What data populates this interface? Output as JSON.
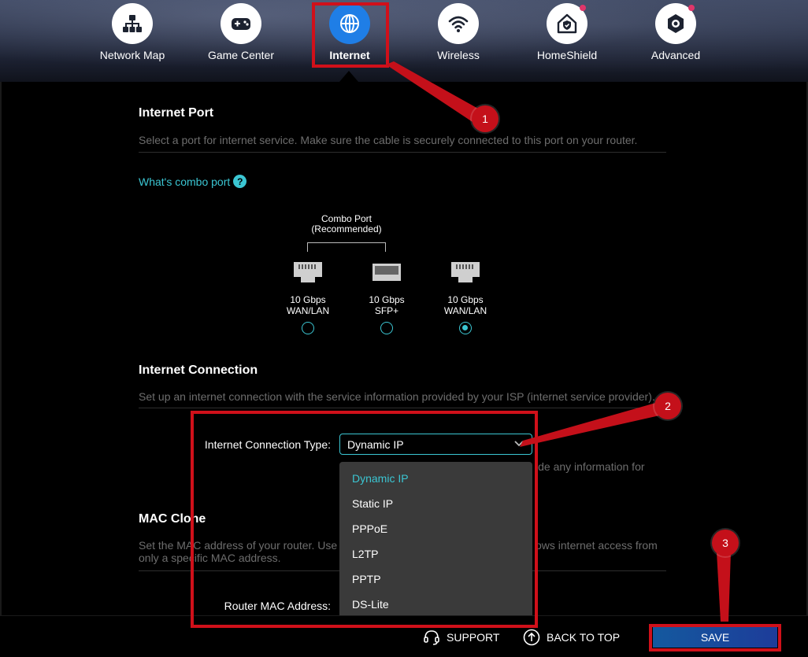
{
  "nav": {
    "items": [
      {
        "label": "Network Map",
        "icon": "network-map-icon"
      },
      {
        "label": "Game Center",
        "icon": "gamepad-icon"
      },
      {
        "label": "Internet",
        "icon": "globe-icon",
        "active": true
      },
      {
        "label": "Wireless",
        "icon": "wifi-icon"
      },
      {
        "label": "HomeShield",
        "icon": "home-shield-icon",
        "notification": true
      },
      {
        "label": "Advanced",
        "icon": "gear-icon",
        "notification": true
      }
    ]
  },
  "internet_port": {
    "title": "Internet Port",
    "description": "Select a port for internet service. Make sure the cable is securely connected to this port on your router.",
    "combo_link": "What's combo port",
    "combo_caption_line1": "Combo Port",
    "combo_caption_line2": "(Recommended)",
    "ports": [
      {
        "speed": "10 Gbps",
        "type": "WAN/LAN",
        "checked": false
      },
      {
        "speed": "10 Gbps",
        "type": "SFP+",
        "checked": false
      },
      {
        "speed": "10 Gbps",
        "type": "WAN/LAN",
        "checked": true
      }
    ]
  },
  "internet_connection": {
    "title": "Internet Connection",
    "description": "Set up an internet connection with the service information provided by your ISP (internet service provider).",
    "type_label": "Internet Connection Type:",
    "selected": "Dynamic IP",
    "options": [
      "Dynamic IP",
      "Static IP",
      "PPPoE",
      "L2TP",
      "PPTP",
      "DS-Lite"
    ],
    "partial_hint": "ide any information for"
  },
  "mac_clone": {
    "title": "MAC Clone",
    "description_left_1": "Set the MAC address of your router. Use",
    "description_right_1": "ows internet access from",
    "description_line2": "only a specific MAC address.",
    "router_mac_label": "Router MAC Address:"
  },
  "bottom": {
    "support": "SUPPORT",
    "back_to_top": "BACK TO TOP",
    "save": "SAVE"
  },
  "annotations": {
    "badge1": "1",
    "badge2": "2",
    "badge3": "3",
    "highlight_color": "#d0101a"
  },
  "colors": {
    "accent": "#3bc6d3",
    "active_nav": "#1f7ee6",
    "notification_dot": "#e0366a"
  }
}
